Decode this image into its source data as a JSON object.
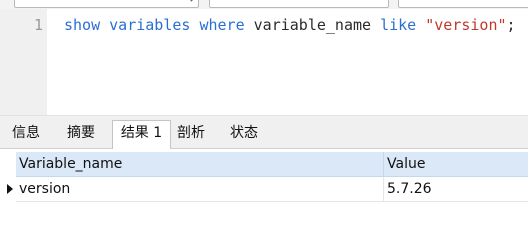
{
  "editor": {
    "line_number": "1",
    "sql": {
      "kw1": "show",
      "kw2": "variables",
      "kw3": "where",
      "ident": "variable_name",
      "kw4": "like",
      "str": "\"version\"",
      "end": ";"
    }
  },
  "tabs": [
    {
      "label": "信息"
    },
    {
      "label": "摘要"
    },
    {
      "label": "结果 1",
      "active": true
    },
    {
      "label": "剖析"
    },
    {
      "label": "状态"
    }
  ],
  "grid": {
    "columns": [
      "Variable_name",
      "Value"
    ],
    "rows": [
      [
        "version",
        "5.7.26"
      ]
    ]
  },
  "colors": {
    "keyword": "#2a6fd6",
    "string": "#c0392b",
    "header_bg": "#dbe8f8"
  }
}
